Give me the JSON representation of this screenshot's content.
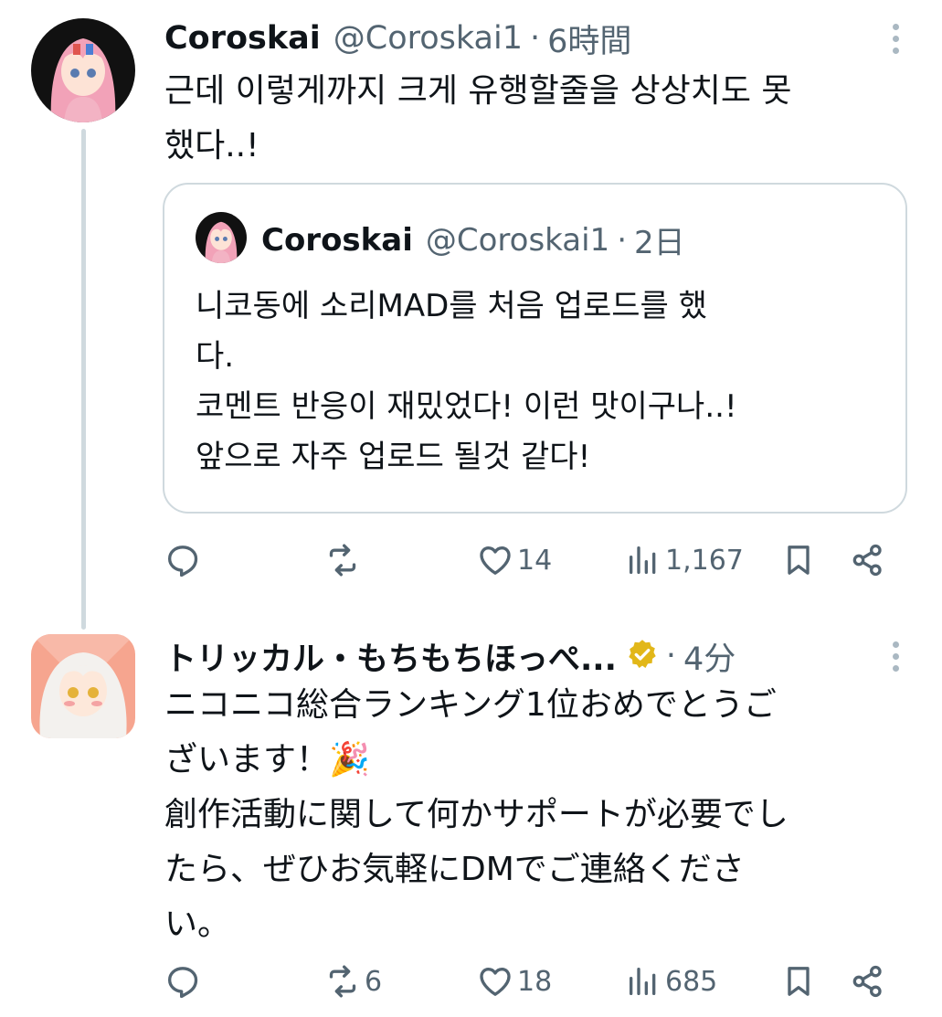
{
  "tweets": [
    {
      "name": "Coroskai",
      "handle": "@Coroskai1",
      "dot": "·",
      "time": "6時間",
      "avatar_icon": "anime-pink-hair-avatar",
      "text": "근데 이렇게까지 크게 유행할줄을 상상치도 못\n했다..!",
      "quote": {
        "name": "Coroskai",
        "handle": "@Coroskai1",
        "dot": "·",
        "time": "2日",
        "text": "니코동에 소리MAD를 처음 업로드를 했\n다.\n코멘트 반응이 재밌었다! 이런 맛이구나..!\n앞으로 자주 업로드 될것 같다!"
      },
      "actions": {
        "reply_count": "",
        "retweet_count": "",
        "like_count": "14",
        "view_count": "1,167"
      }
    },
    {
      "name": "トリッカル・もちもちほっぺ...",
      "verified": true,
      "dot": "·",
      "time": "4分",
      "avatar_icon": "anime-white-hair-avatar",
      "text": "ニコニコ総合ランキング1位おめでとうご\nざいます！🎉\n創作活動に関して何かサポートが必要でし\nたら、ぜひお気軽にDMでご連絡くださ\nい。",
      "actions": {
        "reply_count": "",
        "retweet_count": "6",
        "like_count": "18",
        "view_count": "685"
      }
    }
  ],
  "colors": {
    "text": "#0f1419",
    "secondary": "#536471",
    "border": "#cfd9de",
    "verified_gold": "#e2b719"
  }
}
